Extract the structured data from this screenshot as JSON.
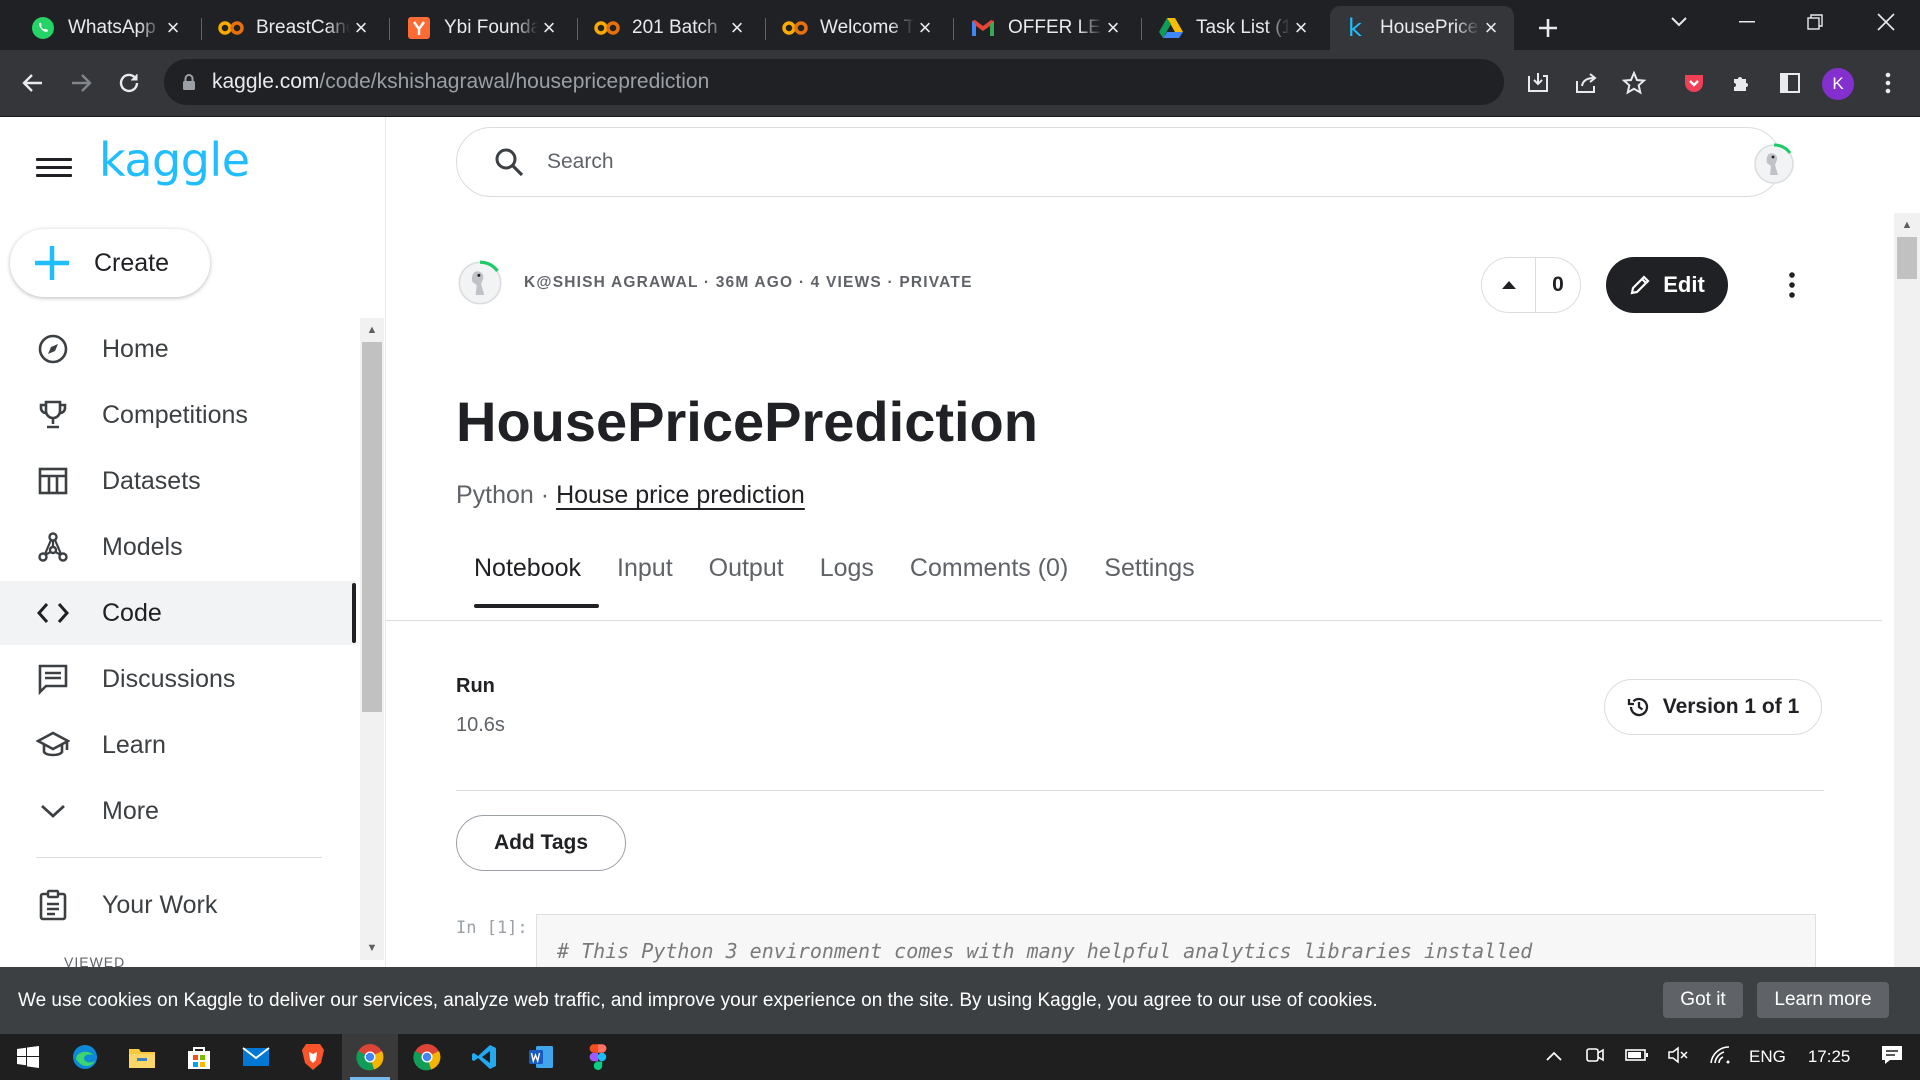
{
  "browser": {
    "tabs": [
      {
        "title": "WhatsApp",
        "icon": "whatsapp-icon"
      },
      {
        "title": "BreastCancer",
        "icon": "colab-icon"
      },
      {
        "title": "Ybi Foundation",
        "icon": "ybi-icon"
      },
      {
        "title": "201 Batch",
        "icon": "colab-icon"
      },
      {
        "title": "Welcome To",
        "icon": "colab-icon"
      },
      {
        "title": "OFFER LETTER",
        "icon": "gmail-icon"
      },
      {
        "title": "Task List (1",
        "icon": "drive-icon"
      },
      {
        "title": "HousePrice",
        "icon": "kaggle-icon",
        "active": true
      }
    ],
    "url_domain": "kaggle.com",
    "url_path": "/code/kshishagrawal/housepriceprediction",
    "profile_initial": "K"
  },
  "sidebar": {
    "logo": "kaggle",
    "create_label": "Create",
    "items": [
      {
        "label": "Home",
        "icon": "compass-icon"
      },
      {
        "label": "Competitions",
        "icon": "trophy-icon"
      },
      {
        "label": "Datasets",
        "icon": "table-icon"
      },
      {
        "label": "Models",
        "icon": "models-icon"
      },
      {
        "label": "Code",
        "icon": "code-icon",
        "active": true
      },
      {
        "label": "Discussions",
        "icon": "comments-icon"
      },
      {
        "label": "Learn",
        "icon": "school-icon"
      },
      {
        "label": "More",
        "icon": "chevron-down-icon"
      },
      {
        "label": "Your Work",
        "icon": "clipboard-icon"
      }
    ],
    "viewed_label": "VIEWED"
  },
  "header": {
    "search_placeholder": "Search"
  },
  "notebook": {
    "author_meta": "K@SHISH AGRAWAL · 36M AGO · 4 VIEWS · PRIVATE",
    "vote_count": "0",
    "edit_label": "Edit",
    "title": "HousePricePrediction",
    "language": "Python · ",
    "dataset_link": "House price prediction",
    "tabs": [
      "Notebook",
      "Input",
      "Output",
      "Logs",
      "Comments (0)",
      "Settings"
    ],
    "active_tab": "Notebook",
    "run_label": "Run",
    "run_time": "10.6s",
    "version_label": "Version 1 of 1",
    "add_tags_label": "Add Tags",
    "cell_prompt": "In [1]:",
    "cell_code": "# This Python 3 environment comes with many helpful analytics libraries installed"
  },
  "cookie_banner": {
    "message": "We use cookies on Kaggle to deliver our services, analyze web traffic, and improve your experience on the site. By using Kaggle, you agree to our use of cookies.",
    "got_it": "Got it",
    "learn_more": "Learn more"
  },
  "taskbar": {
    "lang": "ENG",
    "time": "17:25"
  },
  "colors": {
    "kaggle_blue": "#20beff",
    "chrome_dark": "#202124",
    "chrome_toolbar": "#35363a",
    "cookie_bg": "#3c4043"
  }
}
